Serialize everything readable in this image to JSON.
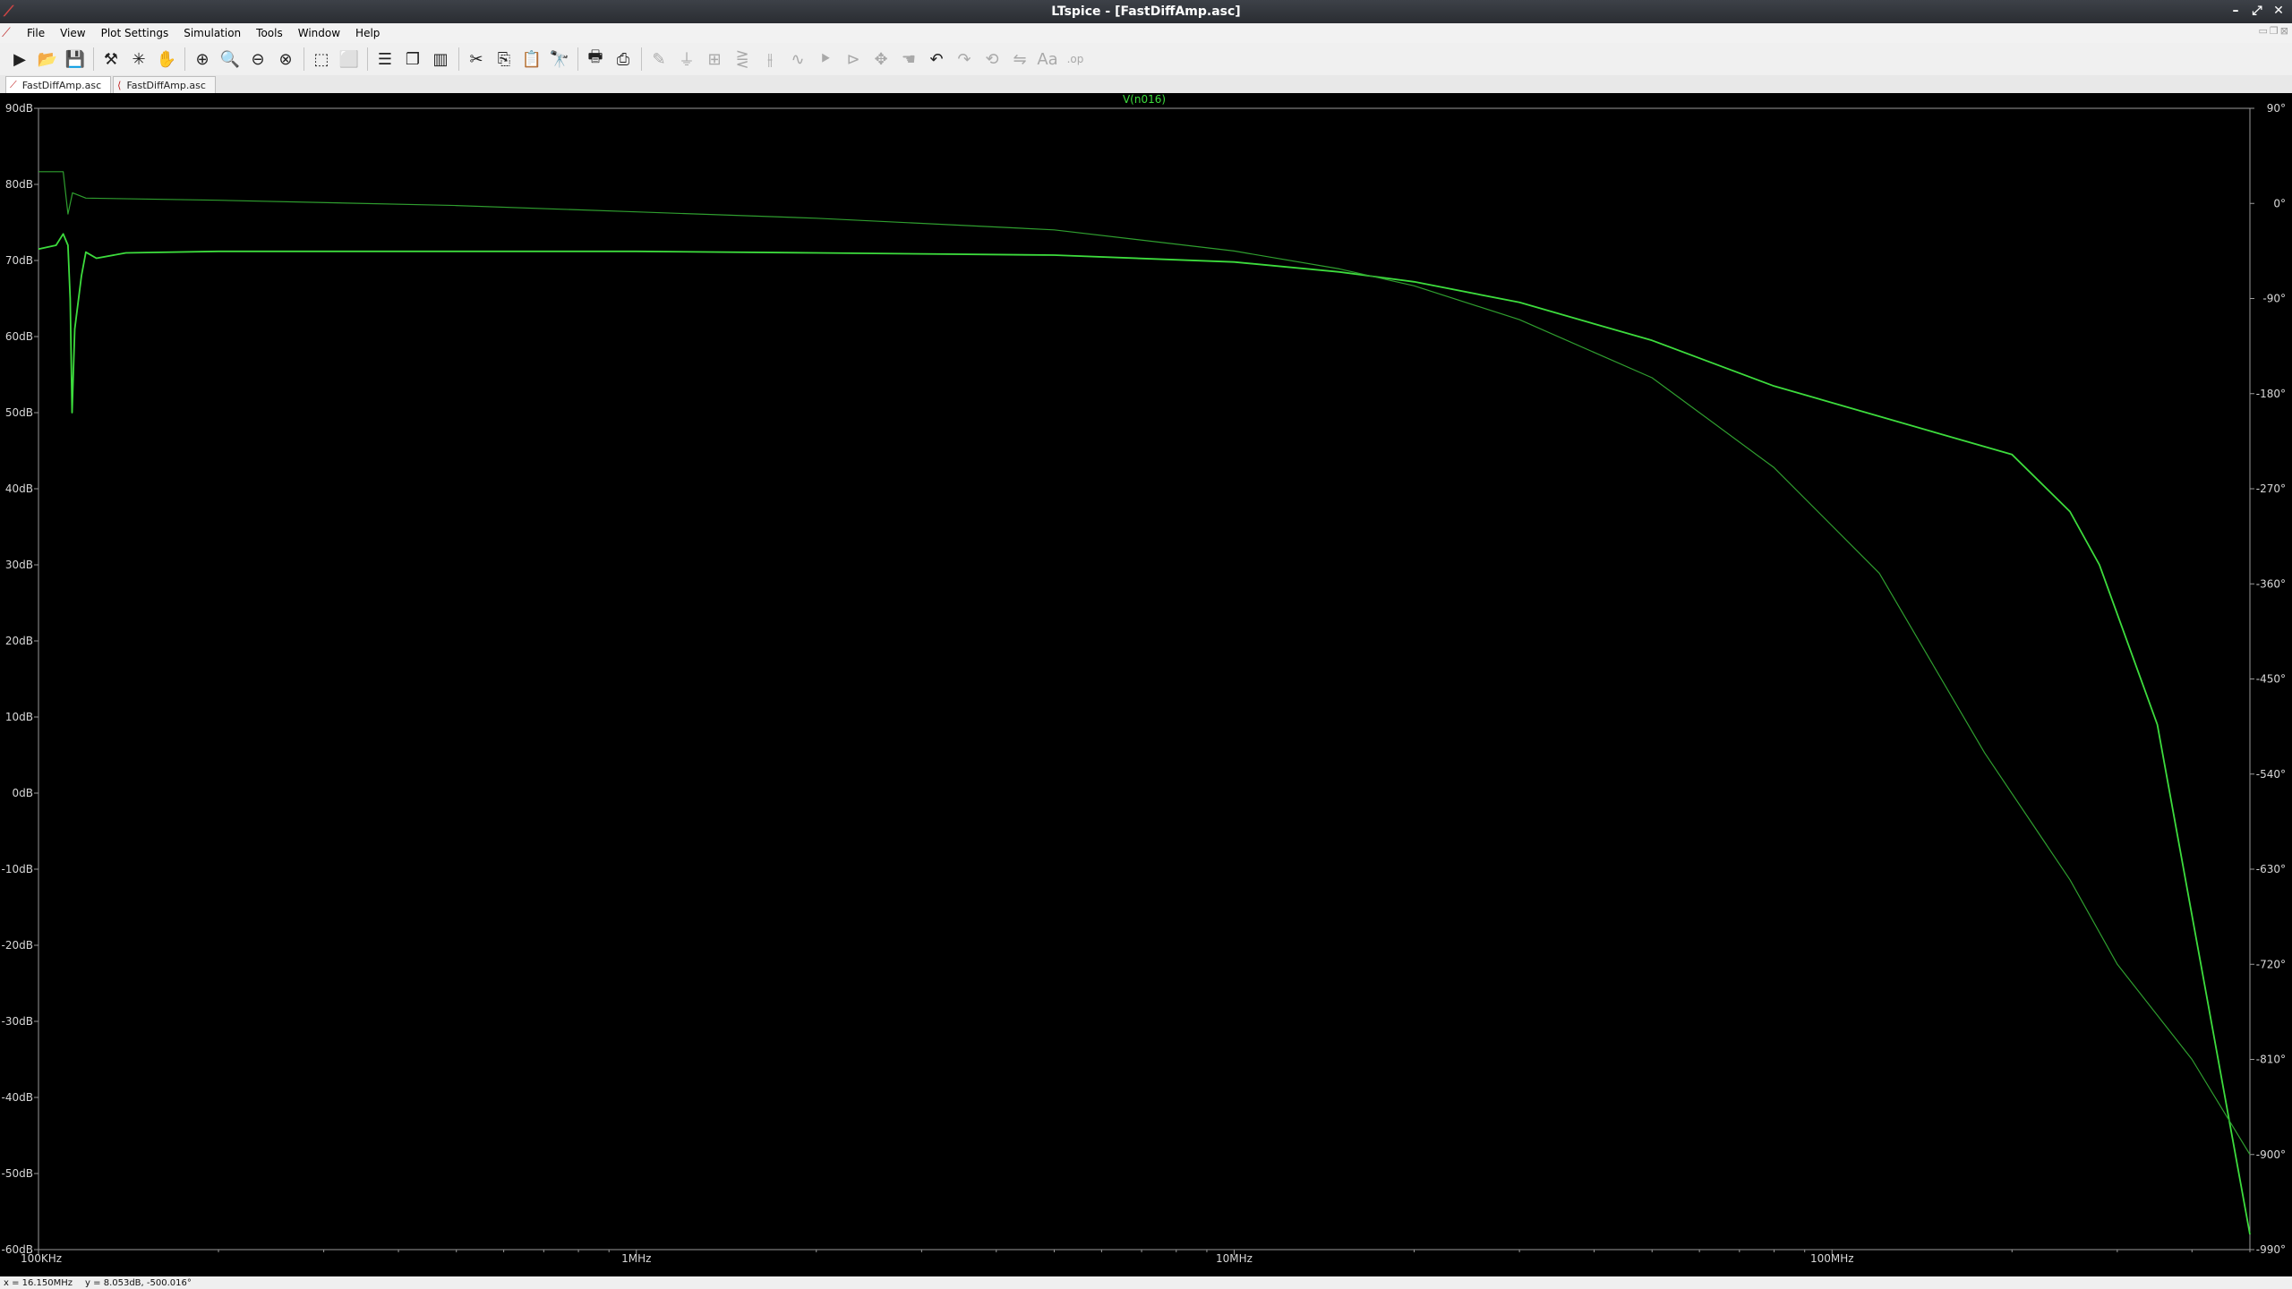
{
  "window": {
    "title": "LTspice - [FastDiffAmp.asc]"
  },
  "menu": [
    "File",
    "View",
    "Plot Settings",
    "Simulation",
    "Tools",
    "Window",
    "Help"
  ],
  "toolbar": [
    {
      "name": "run-icon",
      "glyph": "▶",
      "enabled": true
    },
    {
      "name": "open-icon",
      "glyph": "📂",
      "enabled": true
    },
    {
      "name": "save-icon",
      "glyph": "💾",
      "enabled": true
    },
    {
      "sep": true
    },
    {
      "name": "control-panel-icon",
      "glyph": "⚒",
      "enabled": true
    },
    {
      "name": "halt-icon",
      "glyph": "✳",
      "enabled": true
    },
    {
      "name": "pan-hand-icon",
      "glyph": "✋",
      "enabled": false
    },
    {
      "sep": true
    },
    {
      "name": "zoom-in-icon",
      "glyph": "⊕",
      "enabled": true
    },
    {
      "name": "zoom-area-icon",
      "glyph": "🔍",
      "enabled": true
    },
    {
      "name": "zoom-out-icon",
      "glyph": "⊖",
      "enabled": true
    },
    {
      "name": "zoom-cancel-icon",
      "glyph": "⊗",
      "enabled": true
    },
    {
      "sep": true
    },
    {
      "name": "autorange-icon",
      "glyph": "⬚",
      "enabled": true
    },
    {
      "name": "fit-icon",
      "glyph": "⬜",
      "enabled": true
    },
    {
      "sep": true
    },
    {
      "name": "tile-horizontal-icon",
      "glyph": "☰",
      "enabled": true
    },
    {
      "name": "cascade-icon",
      "glyph": "❐",
      "enabled": true
    },
    {
      "name": "tile-vertical-icon",
      "glyph": "▥",
      "enabled": true
    },
    {
      "sep": true
    },
    {
      "name": "cut-icon",
      "glyph": "✂",
      "enabled": true
    },
    {
      "name": "copy-icon",
      "glyph": "⎘",
      "enabled": true
    },
    {
      "name": "paste-icon",
      "glyph": "📋",
      "enabled": true
    },
    {
      "name": "find-icon",
      "glyph": "🔭",
      "enabled": true
    },
    {
      "sep": true
    },
    {
      "name": "print-icon",
      "glyph": "🖶",
      "enabled": true
    },
    {
      "name": "print-setup-icon",
      "glyph": "⎙",
      "enabled": true
    },
    {
      "sep": true
    },
    {
      "name": "draw-wire-icon",
      "glyph": "✎",
      "enabled": false
    },
    {
      "name": "ground-icon",
      "glyph": "⏚",
      "enabled": false
    },
    {
      "name": "label-net-icon",
      "glyph": "⊞",
      "enabled": false
    },
    {
      "name": "resistor-icon",
      "glyph": "⋛",
      "enabled": false
    },
    {
      "name": "capacitor-icon",
      "glyph": "⫲",
      "enabled": false
    },
    {
      "name": "inductor-icon",
      "glyph": "∿",
      "enabled": false
    },
    {
      "name": "diode-icon",
      "glyph": "⯈",
      "enabled": false
    },
    {
      "name": "component-icon",
      "glyph": "⊳",
      "enabled": false
    },
    {
      "name": "move-icon",
      "glyph": "✥",
      "enabled": false
    },
    {
      "name": "drag-icon",
      "glyph": "☚",
      "enabled": false
    },
    {
      "name": "undo-icon",
      "glyph": "↶",
      "enabled": true
    },
    {
      "name": "redo-icon",
      "glyph": "↷",
      "enabled": false
    },
    {
      "name": "rotate-icon",
      "glyph": "⟲",
      "enabled": false
    },
    {
      "name": "mirror-icon",
      "glyph": "⇋",
      "enabled": false
    },
    {
      "name": "text-icon",
      "glyph": "Aa",
      "enabled": false
    },
    {
      "name": "spice-directive-icon",
      "glyph": ".op",
      "enabled": false
    }
  ],
  "tabs": [
    {
      "label": "FastDiffAmp.asc",
      "active": true
    },
    {
      "label": "FastDiffAmp.asc",
      "active": false
    }
  ],
  "status": {
    "x": "x = 16.150MHz",
    "y": "y = 8.053dB, -500.016°"
  },
  "colors": {
    "trace": "#3ddc3d",
    "trace_phase": "#2f9e2f",
    "axis_text": "#d8d8d8",
    "background": "#000000"
  },
  "chart_data": {
    "type": "line",
    "title": "V(n016)",
    "x_scale": "log",
    "xlim": [
      100000,
      500000000
    ],
    "ylim": [
      -60,
      90
    ],
    "y2lim": [
      -990,
      90
    ],
    "x_ticks": [
      {
        "v": 100000,
        "label": "100KHz"
      },
      {
        "v": 1000000,
        "label": "1MHz"
      },
      {
        "v": 10000000,
        "label": "10MHz"
      },
      {
        "v": 100000000,
        "label": "100MHz"
      }
    ],
    "y_ticks": [
      "90dB",
      "80dB",
      "70dB",
      "60dB",
      "50dB",
      "40dB",
      "30dB",
      "20dB",
      "10dB",
      "0dB",
      "-10dB",
      "-20dB",
      "-30dB",
      "-40dB",
      "-50dB",
      "-60dB"
    ],
    "y_tick_values": [
      90,
      80,
      70,
      60,
      50,
      40,
      30,
      20,
      10,
      0,
      -10,
      -20,
      -30,
      -40,
      -50,
      -60
    ],
    "y2_ticks": [
      "90°",
      "0°",
      "-90°",
      "-180°",
      "-270°",
      "-360°",
      "-450°",
      "-540°",
      "-630°",
      "-720°",
      "-810°",
      "-900°",
      "-990°"
    ],
    "y2_tick_values": [
      90,
      0,
      -90,
      -180,
      -270,
      -360,
      -450,
      -540,
      -630,
      -720,
      -810,
      -900,
      -990
    ],
    "series": [
      {
        "name": "V(n016)",
        "role": "magnitude",
        "axis": "left",
        "x": [
          100000,
          107000,
          110000,
          112000,
          113000,
          113800,
          115000,
          118000,
          125000,
          140000,
          200000,
          500000,
          1000000,
          2000000,
          5000000,
          10000000,
          15000000,
          20000000,
          30000000,
          50000000,
          80000000,
          120000,
          200000000,
          250000000,
          280000000,
          350000000,
          500000000
        ],
        "y": [
          71.5,
          72,
          73.5,
          72,
          65,
          50,
          61,
          68,
          70.3,
          71,
          71.2,
          71.2,
          71.2,
          71.0,
          70.7,
          69.8,
          68.5,
          67.2,
          64.5,
          59.5,
          53.5,
          71.1,
          44.5,
          37,
          30,
          9,
          -58
        ]
      },
      {
        "name": "V(n016)",
        "role": "phase",
        "axis": "right",
        "x": [
          100000,
          110000,
          112000,
          114000,
          120000,
          200000,
          500000,
          1000000,
          2000000,
          5000000,
          10000000,
          15000000,
          20000000,
          30000000,
          50000000,
          80000000,
          120000000,
          180000000,
          250000000,
          300000000,
          400000000,
          500000000
        ],
        "y": [
          30,
          30,
          -10,
          10,
          5,
          3,
          -2,
          -8,
          -14,
          -25,
          -45,
          -62,
          -78,
          -110,
          -165,
          -250,
          -350,
          -520,
          -640,
          -720,
          -810,
          -900
        ]
      }
    ]
  }
}
